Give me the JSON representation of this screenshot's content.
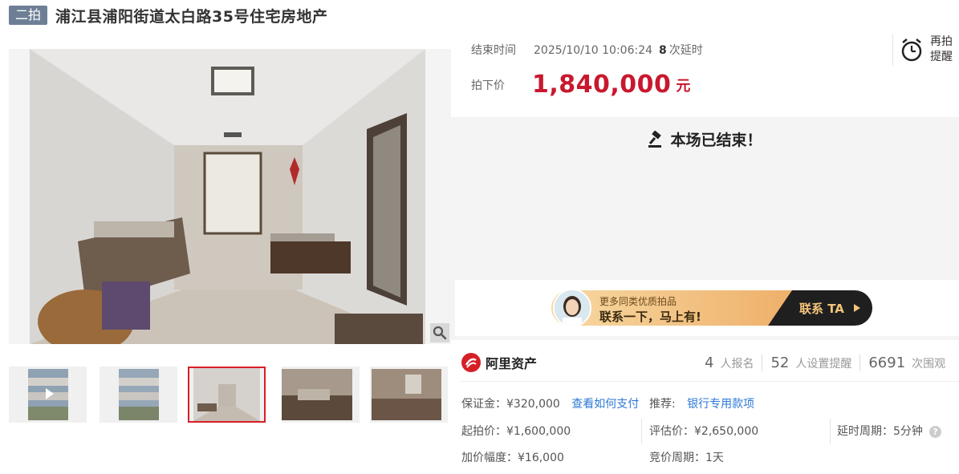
{
  "header": {
    "round_tag": "二拍",
    "title": "浦江县浦阳街道太白路35号住宅房地产"
  },
  "auction": {
    "end_time_label": "结束时间",
    "end_time_value": "2025/10/10 10:06:24",
    "delay_count": "8",
    "delay_label": "次延时",
    "price_label": "拍下价",
    "price_value": "1,840,000",
    "price_unit": "元",
    "remind_label": "再拍提醒",
    "ended_message": "本场已结束！"
  },
  "banner": {
    "subtitle": "更多同类优质拍品",
    "main": "联系一下，马上有!",
    "cta": "联系 TA"
  },
  "stats": {
    "brand": "阿里资产",
    "items": [
      {
        "count": "4",
        "label": "人报名"
      },
      {
        "count": "52",
        "label": "人设置提醒"
      },
      {
        "count": "6691",
        "label": "次围观"
      }
    ]
  },
  "details": {
    "deposit": "保证金：¥320,000",
    "deposit_link": "查看如何支付",
    "recommend_label": "推荐:",
    "recommend_link": "银行专用款项",
    "start_price": "起拍价：¥1,600,000",
    "appraisal": "评估价：¥2,650,000",
    "delay_period": "延时周期：5分钟",
    "increment": "加价幅度：¥16,000",
    "bid_period": "竞价周期：1天"
  },
  "gallery": {
    "selected_index": 2,
    "thumbnail_count": 5
  },
  "colors": {
    "price_red": "#c8182e",
    "tag_gray": "#6e7f95",
    "link_blue": "#2d78d5"
  }
}
